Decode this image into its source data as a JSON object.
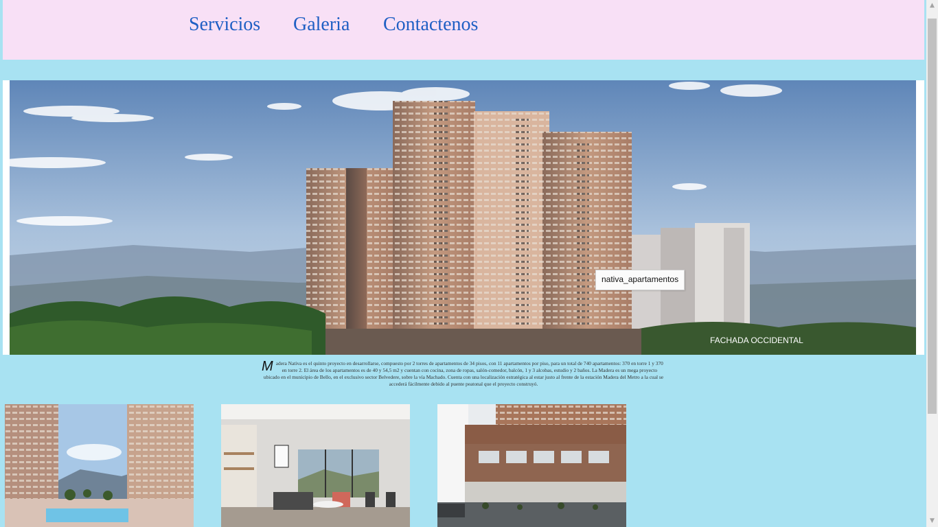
{
  "nav": {
    "items": [
      "Servicios",
      "Galeria",
      "Contactenos"
    ]
  },
  "hero": {
    "tooltip": "nativa_apartamentos",
    "caption": "FACHADA OCCIDENTAL"
  },
  "description": {
    "dropcap": "M",
    "text": "adera Nativa es el quinto proyecto en desarrollarse, compuesto por 2 torres de apartamentos de 34 pisos, con 11 apartamentos por piso, para un total de 740 apartamentos: 370 en torre 1 y 370 en torre 2. El área de los apartamentos es de 40 y 54,5 m2 y cuentan con cocina, zona de ropas, salón-comedor, balcón, 1 y 3 alcobas, estudio y 2 baños. La Madera es un mega proyecto ubicado en el municipio de Bello, en el exclusivo sector Belvedere, sobre la vía Machado. Cuenta con una localización estratégica al estar justo al frente de la estación Madera del Metro a la cual se accederá fácilmente debido al puente peatonal que el proyecto construyó."
  },
  "gallery": [
    "pool-amenity-image",
    "living-room-image",
    "building-facade-image"
  ],
  "colors": {
    "page_bg": "#a8e2f2",
    "nav_bg": "#f8e0f6",
    "link": "#1f5fc4"
  }
}
